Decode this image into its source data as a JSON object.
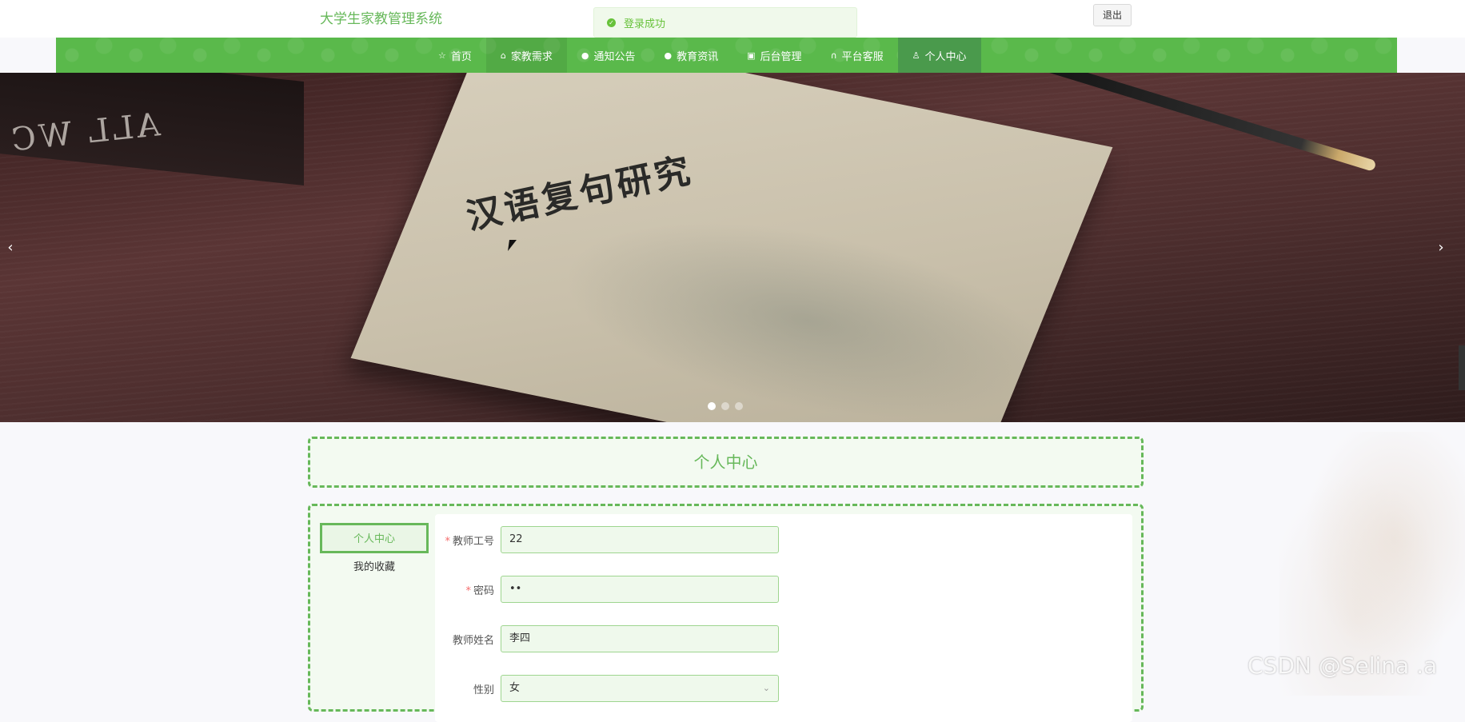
{
  "header": {
    "site_title": "大学生家教管理系统",
    "logout_label": "退出"
  },
  "toast": {
    "message": "登录成功",
    "icon": "success-check-icon",
    "color": "#67c23a"
  },
  "nav": {
    "items": [
      {
        "label": "首页",
        "icon": "star-icon"
      },
      {
        "label": "家教需求",
        "icon": "home-icon"
      },
      {
        "label": "通知公告",
        "icon": "dot-icon"
      },
      {
        "label": "教育资讯",
        "icon": "dot-icon"
      },
      {
        "label": "后台管理",
        "icon": "briefcase-icon"
      },
      {
        "label": "平台客服",
        "icon": "headset-icon"
      },
      {
        "label": "个人中心",
        "icon": "user-icon"
      }
    ],
    "active_index": 6,
    "bg_color": "#5ab94b"
  },
  "banner": {
    "book_title": "汉语复句研究",
    "left_book_text": "ALL WC",
    "prev_label": "‹",
    "next_label": "›",
    "slide_count": 3,
    "active_slide": 0
  },
  "page": {
    "section_title": "个人中心"
  },
  "side_menu": {
    "items": [
      "个人中心",
      "我的收藏"
    ],
    "active_index": 0
  },
  "form": {
    "fields": [
      {
        "label": "教师工号",
        "value": "22",
        "required": true
      },
      {
        "label": "密码",
        "value": "••",
        "required": true
      },
      {
        "label": "教师姓名",
        "value": "李四",
        "required": false
      },
      {
        "label": "性别",
        "value": "女",
        "required": false,
        "type": "select"
      }
    ]
  },
  "watermark": "CSDN @Selina .a",
  "theme": {
    "accent": "#67b85a",
    "required_color": "#f56c6c"
  }
}
